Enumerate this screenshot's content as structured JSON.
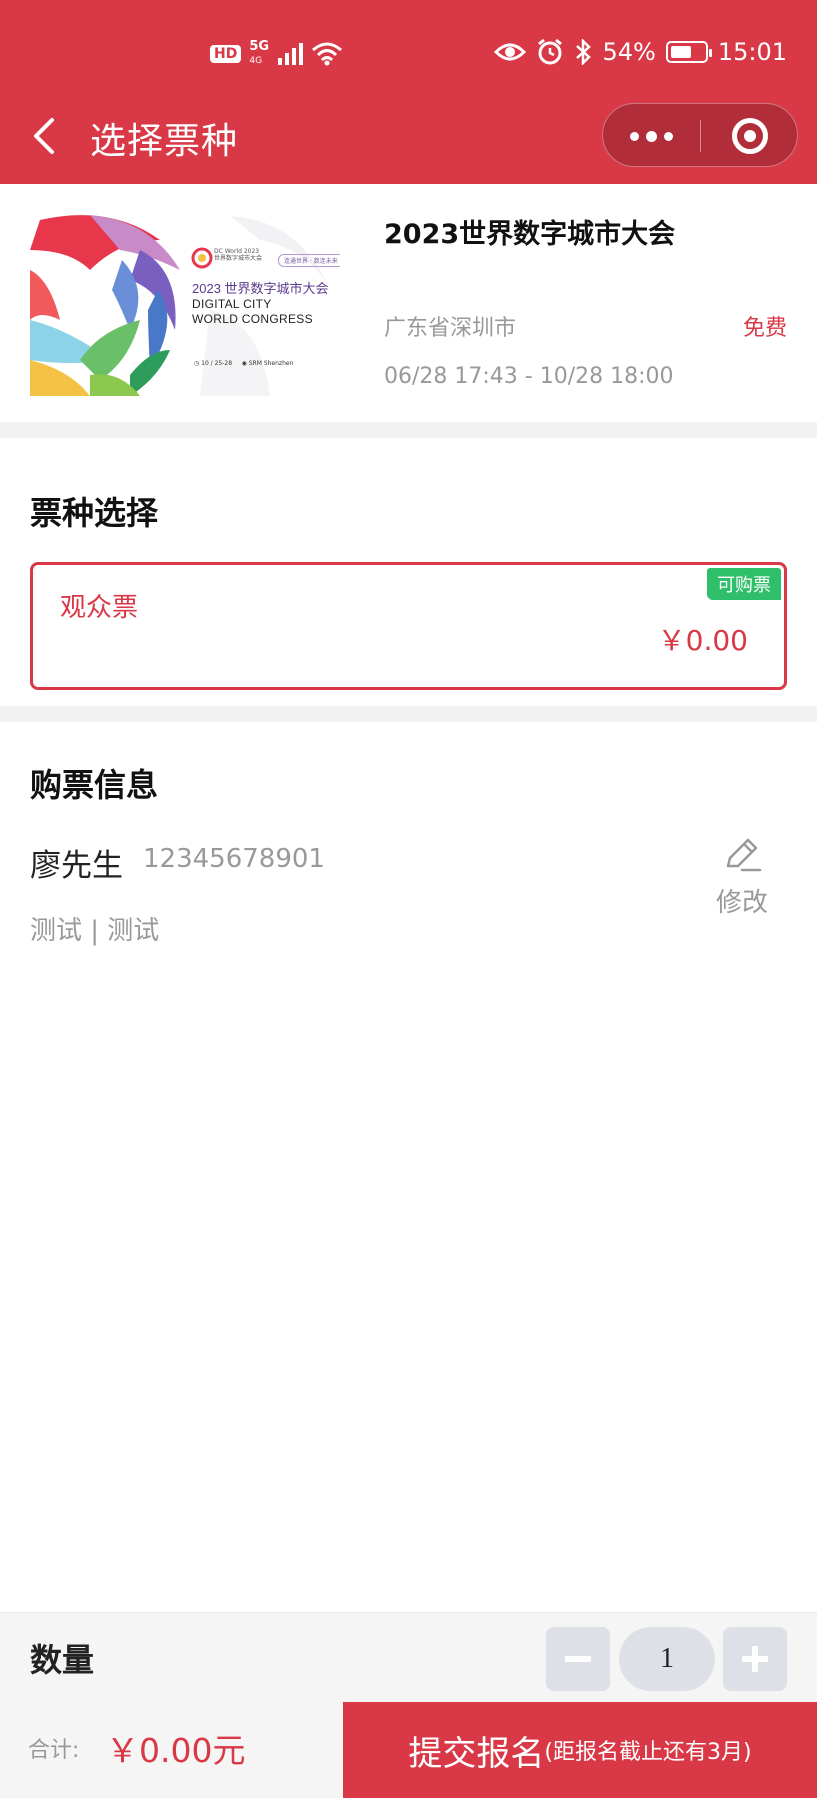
{
  "colors": {
    "brand": "#d93847",
    "available_badge": "#2fbe6a",
    "muted": "#999999"
  },
  "status_bar": {
    "hd": "HD",
    "network": "5G",
    "network_sub": "4G",
    "battery_text": "54%",
    "battery_level": 0.54,
    "time": "15:01",
    "icons": [
      "signal-icon",
      "wifi-icon",
      "eye-icon",
      "alarm-icon",
      "bluetooth-icon",
      "battery-icon"
    ]
  },
  "navbar": {
    "title": "选择票种"
  },
  "event": {
    "title": "2023世界数字城市大会",
    "location": "广东省深圳市",
    "price": "免费",
    "time_range": "06/28 17:43 - 10/28 18:00",
    "poster": {
      "title_cn": "2023 世界数字城市大会",
      "title_en_1": "DIGITAL CITY",
      "title_en_2": "WORLD CONGRESS",
      "logo_text_1": "DC World 2023",
      "logo_text_2": "世界数字城市大会",
      "tag": "连通世界 · 数连未来",
      "foot_date": "◷ 10 / 25-28",
      "foot_place": "◉ SRM Shenzhen"
    }
  },
  "ticket_section": {
    "title": "票种选择",
    "tickets": [
      {
        "name": "观众票",
        "price": "￥0.00",
        "badge": "可购票",
        "selected": true
      }
    ]
  },
  "buyer_section": {
    "title": "购票信息",
    "name": "廖先生",
    "phone": "12345678901",
    "tags": "测试 | 测试",
    "edit_label": "修改"
  },
  "quantity": {
    "label": "数量",
    "value": "1"
  },
  "bottom": {
    "total_label": "合计:",
    "total_value": "￥0.00元",
    "submit_main": "提交报名",
    "submit_sub": "(距报名截止还有3月)"
  }
}
